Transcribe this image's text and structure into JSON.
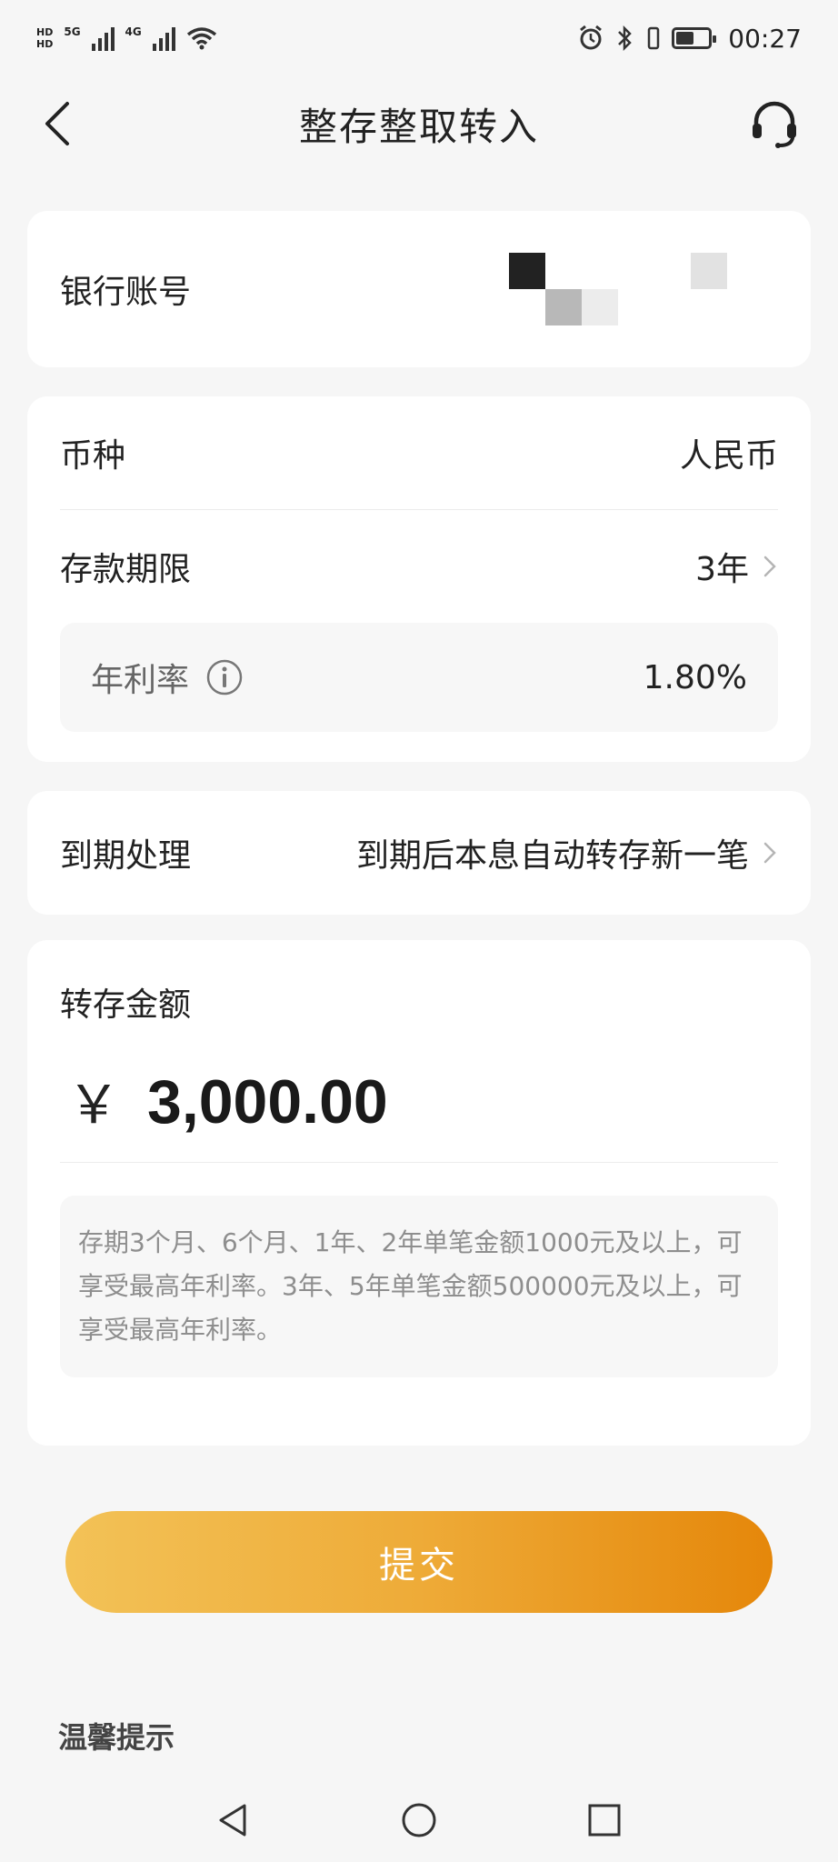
{
  "status_bar": {
    "network_1": "5G",
    "network_2": "4G",
    "time": "00:27"
  },
  "nav": {
    "title": "整存整取转入"
  },
  "account_card": {
    "label": "银行账号",
    "value_masked": ""
  },
  "deposit_card": {
    "currency_label": "币种",
    "currency_value": "人民币",
    "term_label": "存款期限",
    "term_value": "3年",
    "rate_label": "年利率",
    "rate_value": "1.80%"
  },
  "maturity_card": {
    "label": "到期处理",
    "value": "到期后本息自动转存新一笔"
  },
  "amount_card": {
    "label": "转存金额",
    "currency_symbol": "￥",
    "amount": "3,000.00",
    "notice": "存期3个月、6个月、1年、2年单笔金额1000元及以上，可享受最高年利率。3年、5年单笔金额500000元及以上，可享受最高年利率。"
  },
  "submit": {
    "label": "提交"
  },
  "tips": {
    "title": "温馨提示"
  }
}
